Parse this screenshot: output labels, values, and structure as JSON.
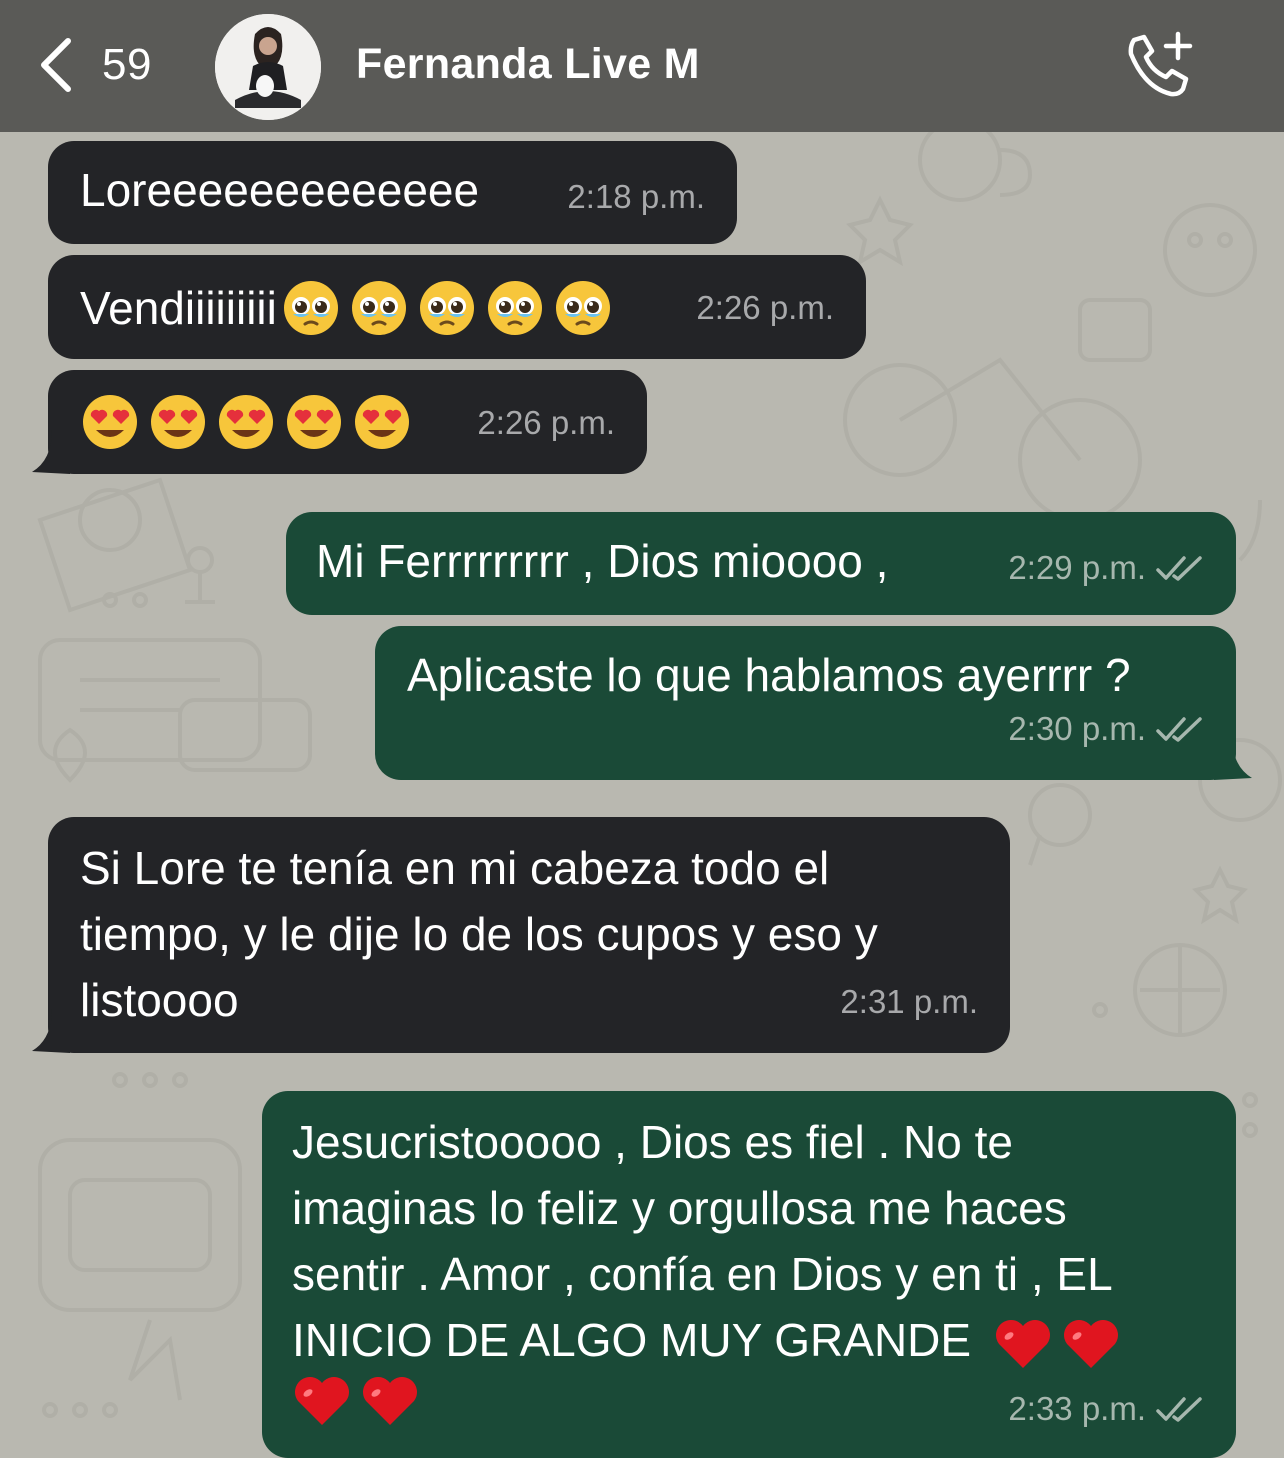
{
  "header": {
    "back_count": "59",
    "contact_name": "Fernanda Live M"
  },
  "messages": [
    {
      "text": "Loreeeeeeeeeeeee",
      "time": "2:18 p.m."
    },
    {
      "text": "Vendiiiiiiiii",
      "emojis": [
        "pleading-face",
        "pleading-face",
        "pleading-face",
        "pleading-face",
        "pleading-face"
      ],
      "time": "2:26 p.m."
    },
    {
      "emojis": [
        "heart-eyes-face",
        "heart-eyes-face",
        "heart-eyes-face",
        "heart-eyes-face",
        "heart-eyes-face"
      ],
      "time": "2:26 p.m."
    },
    {
      "text": "Mi Ferrrrrrrrr , Dios mioooo ,",
      "time": "2:29 p.m."
    },
    {
      "text": "Aplicaste lo que hablamos ayerrrr ?",
      "time": "2:30 p.m."
    },
    {
      "lines": [
        "Si Lore te tenía en mi cabeza todo el",
        "tiempo, y le dije lo de los cupos y eso y",
        "listoooo"
      ],
      "time": "2:31 p.m."
    },
    {
      "lines": [
        "Jesucristooooo , Dios es fiel . No te",
        "imaginas lo feliz y orgullosa me haces",
        "sentir . Amor , confía en Dios y en ti , EL",
        "INICIO DE ALGO MUY GRANDE"
      ],
      "trailing_emojis": [
        "red-heart",
        "red-heart",
        "red-heart",
        "red-heart"
      ],
      "time": "2:33 p.m."
    }
  ],
  "colors": {
    "header_bg": "#5a5a57",
    "wallpaper": "#b9b8b0",
    "incoming_bubble": "#232427",
    "outgoing_bubble": "#1a4a37",
    "read_ticks": "#a6b7ae"
  }
}
